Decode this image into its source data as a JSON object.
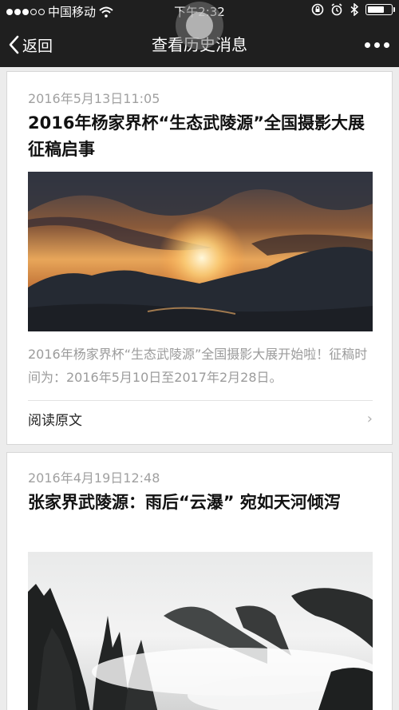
{
  "status_bar": {
    "carrier": "中国移动",
    "time": "下午2:32",
    "battery_level": 0.75
  },
  "nav": {
    "back_label": "返回",
    "title": "查看历史消息"
  },
  "articles": [
    {
      "date": "2016年5月13日11:05",
      "title": "2016年杨家界杯“生态武陵源”全国摄影大展征稿启事",
      "summary": "2016年杨家界杯“生态武陵源”全国摄影大展开始啦！征稿时间为：2016年5月10日至2017年2月28日。",
      "read_more": "阅读原文"
    },
    {
      "date": "2016年4月19日12:48",
      "title": "张家界武陵源：雨后“云瀑” 宛如天河倾泻"
    }
  ],
  "colors": {
    "bar_background": "#1f1f1f",
    "page_background": "#ececec",
    "meta_text": "#a0a0a0"
  }
}
